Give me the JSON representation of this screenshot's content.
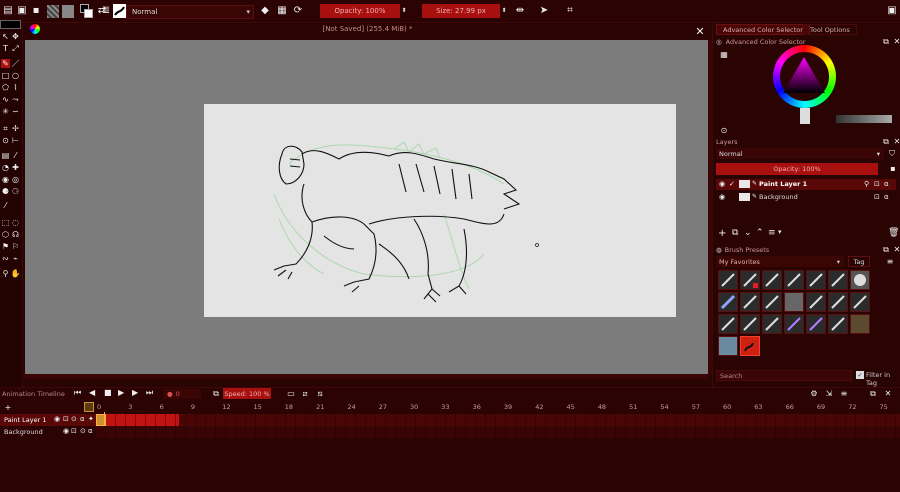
{
  "colors": {
    "accent": "#a80f0f",
    "bg": "#2a0303",
    "canvas_bg": "#7c7c7c",
    "paper": "#e4e4e4"
  },
  "toolbar": {
    "blend_mode": "Normal",
    "opacity": "Opacity: 100%",
    "size": "Size: 27.99 px"
  },
  "document": {
    "title": "[Not Saved]  (255.4 MiB) *"
  },
  "dock": {
    "tabs": [
      "Advanced Color Selector",
      "Tool Options"
    ],
    "color_panel_title": "Advanced Color Selector",
    "layers_title": "Layers",
    "layers_blend": "Normal",
    "layers_opacity": "Opacity:  100%",
    "layers": [
      {
        "name": "Paint Layer 1"
      },
      {
        "name": "Background"
      }
    ],
    "brush_title": "Brush Presets",
    "brush_tag": "My Favorites",
    "tag_label": "Tag",
    "search_placeholder": "Search",
    "filter_label": "Filter in Tag"
  },
  "timeline": {
    "title": "Animation Timeline",
    "frame": "0",
    "speed": "Speed: 100 %",
    "layers": [
      {
        "name": "Paint Layer 1"
      },
      {
        "name": "Background"
      }
    ],
    "frame_numbers": [
      "0",
      "3",
      "6",
      "9",
      "12",
      "15",
      "18",
      "21",
      "24",
      "27",
      "30",
      "33",
      "36",
      "39",
      "42",
      "45",
      "48",
      "51",
      "54",
      "57",
      "60",
      "63",
      "66",
      "69",
      "72",
      "75"
    ]
  }
}
